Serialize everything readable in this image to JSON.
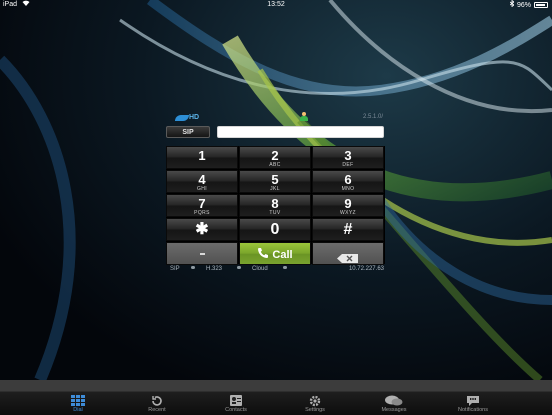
{
  "status_bar": {
    "device": "iPad",
    "wifi_icon": "wifi-icon",
    "time": "13:52",
    "bluetooth_icon": "bluetooth-icon",
    "battery": "96%"
  },
  "brand": {
    "logo_text": "HD",
    "version": "2.5.1.0/"
  },
  "sip": {
    "button_label": "SIP",
    "input_value": "",
    "input_placeholder": ""
  },
  "keypad": {
    "keys": [
      {
        "num": "1",
        "letters": ""
      },
      {
        "num": "2",
        "letters": "ABC"
      },
      {
        "num": "3",
        "letters": "DEF"
      },
      {
        "num": "4",
        "letters": "GHI"
      },
      {
        "num": "5",
        "letters": "JKL"
      },
      {
        "num": "6",
        "letters": "MNO"
      },
      {
        "num": "7",
        "letters": "PQRS"
      },
      {
        "num": "8",
        "letters": "TUV"
      },
      {
        "num": "9",
        "letters": "WXYZ"
      },
      {
        "num": "✱",
        "letters": ""
      },
      {
        "num": "0",
        "letters": ""
      },
      {
        "num": "#",
        "letters": ""
      }
    ],
    "call_label": "Call"
  },
  "status": {
    "sip": "SIP",
    "h323": "H.323",
    "cloud": "Cloud",
    "ip": "10.72.227.63"
  },
  "tabs": [
    {
      "label": "Dial",
      "icon": "dialpad-icon",
      "active": true
    },
    {
      "label": "Recent",
      "icon": "recent-icon",
      "active": false
    },
    {
      "label": "Contacts",
      "icon": "contacts-icon",
      "active": false
    },
    {
      "label": "Settings",
      "icon": "gear-icon",
      "active": false
    },
    {
      "label": "Messages",
      "icon": "messages-icon",
      "active": false
    },
    {
      "label": "Notifications",
      "icon": "notifications-icon",
      "active": false
    }
  ],
  "colors": {
    "accent": "#3e8cd8",
    "call_green": "#7aa52b"
  }
}
